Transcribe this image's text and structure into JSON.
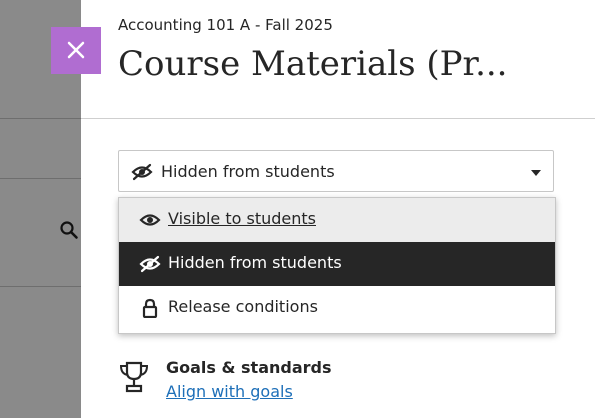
{
  "header": {
    "course_title": "Accounting 101 A - Fall 2025",
    "page_title": "Course Materials (Pr..."
  },
  "close_button": {
    "icon": "close-icon",
    "color": "#b06dd1"
  },
  "visibility": {
    "selected_label": "Hidden from students",
    "selected_icon": "eye-slash-icon",
    "options": [
      {
        "label": "Visible to students",
        "icon": "eye-icon"
      },
      {
        "label": "Hidden from students",
        "icon": "eye-slash-icon"
      },
      {
        "label": "Release conditions",
        "icon": "lock-icon"
      }
    ]
  },
  "goals": {
    "icon": "trophy-icon",
    "heading": "Goals & standards",
    "link": "Align with goals"
  },
  "background": {
    "icon": "search-icon"
  }
}
